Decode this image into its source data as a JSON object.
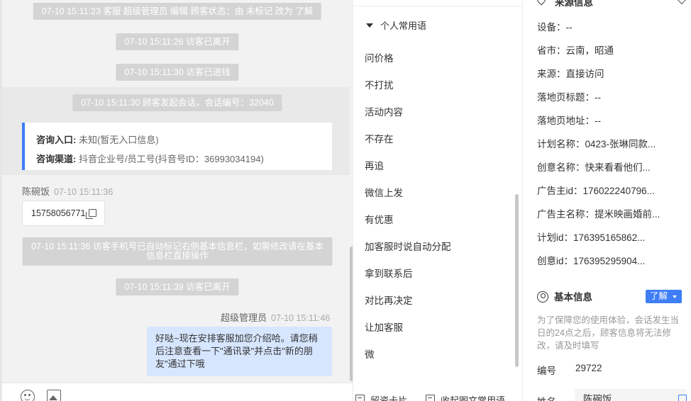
{
  "chat": {
    "system_messages": [
      "07-10 15:11:23 客服 超级管理员 编辑 顾客状态：由 未标记 改为 了解",
      "07-10 15:11:26 访客已离开",
      "07-10 15:11:30 访客已进线",
      "07-10 15:11:30 顾客发起会话，会话编号：32040",
      "07-10 15:11:36 访客手机号已自动标记右侧基本信息栏，如需修改请在基本信息栏直接操作",
      "07-10 15:11:39 访客已离开"
    ],
    "info_card": {
      "entry_label": "咨询入口:",
      "entry_value": "未知(暂无入口信息)",
      "channel_label": "咨询渠道:",
      "channel_value": "抖音企业号/员工号(抖音号ID：36993034194)"
    },
    "visitor": {
      "name": "陈碗饭",
      "time": "07-10 15:11:36",
      "message": "15758056771"
    },
    "agent": {
      "name": "超级管理员",
      "time": "07-10 15:11:46",
      "message": "好哒~现在安排客服加您介绍哈。请您稍后注意查看一下\"通讯录\"并点击\"新的朋友\"通过下哦"
    }
  },
  "phrases": {
    "group_title": "个人常用语",
    "items": [
      "问价格",
      "不打扰",
      "活动内容",
      "不存在",
      "再追",
      "微信上发",
      "有优惠",
      "加客服时说自动分配",
      "拿到联系后",
      "对比再决定",
      "让加客服",
      "微"
    ],
    "footer": {
      "card_label": "留资卡片",
      "collapse_label": "收起图文常用语"
    }
  },
  "info": {
    "source_title": "来源信息",
    "fields": [
      "设备：--",
      "省市：云南，昭通",
      "来源：直接访问",
      "落地页标题：--",
      "落地页地址：--",
      "计划名称：0423-张琳同款...",
      "创意名称：快来看看他们...",
      "广告主id：176022240796...",
      "广告主名称：提米映画婚前...",
      "计划id：176395165862...",
      "创意id：176395295904..."
    ],
    "basic_title": "基本信息",
    "status_tag": "了解",
    "note": "为了保障您的使用体验，会话发生当日的24点之后，顾客信息将无法修改，请及时填写",
    "id_label": "编号",
    "id_value": "29722",
    "name_label": "姓名",
    "name_value": "陈碗饭"
  }
}
